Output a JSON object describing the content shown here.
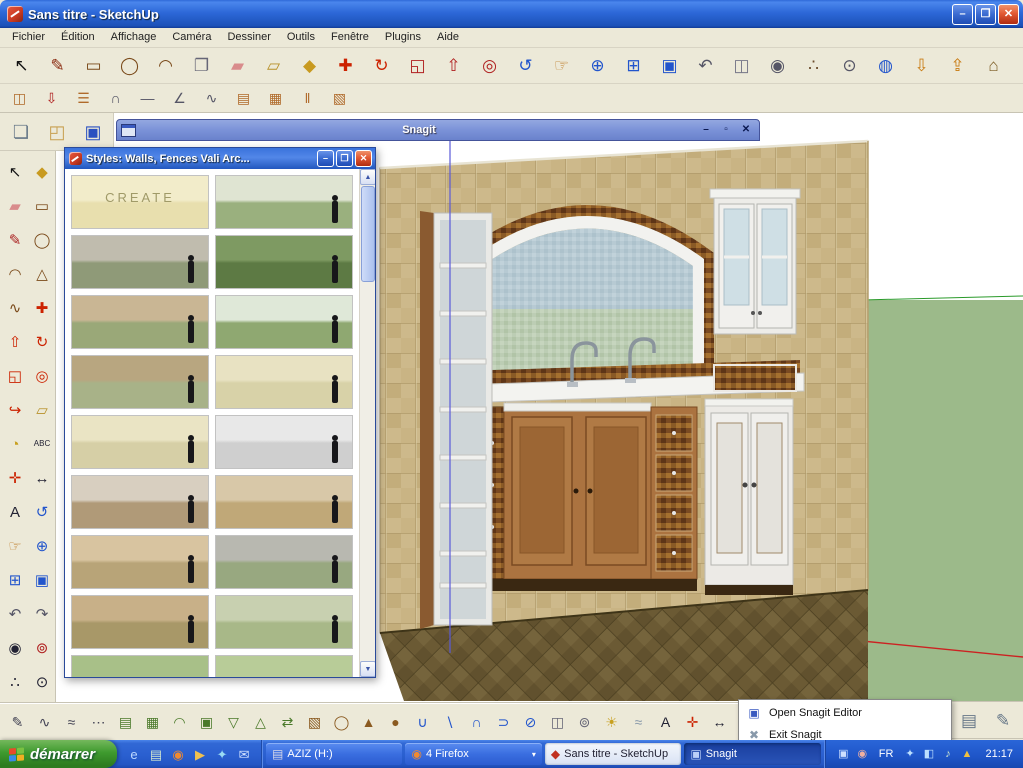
{
  "title_bar": {
    "title": "Sans titre - SketchUp",
    "controls": [
      {
        "n": "minimize-button",
        "g": "–"
      },
      {
        "n": "maximize-button",
        "g": "❐"
      },
      {
        "n": "close-button",
        "g": "✕"
      }
    ]
  },
  "menu_bar": {
    "items": [
      {
        "name": "menu-fichier",
        "label": "Fichier"
      },
      {
        "name": "menu-edition",
        "label": "Édition"
      },
      {
        "name": "menu-affichage",
        "label": "Affichage"
      },
      {
        "name": "menu-camera",
        "label": "Caméra"
      },
      {
        "name": "menu-dessiner",
        "label": "Dessiner"
      },
      {
        "name": "menu-outils",
        "label": "Outils"
      },
      {
        "name": "menu-fenetre",
        "label": "Fenêtre"
      },
      {
        "name": "menu-plugins",
        "label": "Plugins"
      },
      {
        "name": "menu-aide",
        "label": "Aide"
      }
    ]
  },
  "toolbar_main": {
    "icons": [
      {
        "n": "select-icon",
        "g": "↖",
        "c": "#111111"
      },
      {
        "n": "line-icon",
        "g": "✎",
        "c": "#8a2a10"
      },
      {
        "n": "rectangle-icon",
        "g": "▭",
        "c": "#7a4a1a"
      },
      {
        "n": "circle-icon",
        "g": "◯",
        "c": "#7a4a1a"
      },
      {
        "n": "arc-icon",
        "g": "◠",
        "c": "#7a4a1a"
      },
      {
        "n": "make-component-icon",
        "g": "❐",
        "c": "#666677"
      },
      {
        "n": "eraser-icon",
        "g": "▰",
        "c": "#d98c8c"
      },
      {
        "n": "tape-measure-icon",
        "g": "▱",
        "c": "#b8912a"
      },
      {
        "n": "paint-bucket-icon",
        "g": "◆",
        "c": "#c89a20"
      },
      {
        "n": "move-icon",
        "g": "✚",
        "c": "#cc2200"
      },
      {
        "n": "rotate-icon",
        "g": "↻",
        "c": "#cc2200"
      },
      {
        "n": "scale-icon",
        "g": "◱",
        "c": "#b02020"
      },
      {
        "n": "push-pull-icon",
        "g": "⇧",
        "c": "#b02020"
      },
      {
        "n": "offset-icon",
        "g": "◎",
        "c": "#b02020"
      },
      {
        "n": "orbit-icon",
        "g": "↺",
        "c": "#2255cc"
      },
      {
        "n": "pan-icon",
        "g": "☞",
        "c": "#c08030"
      },
      {
        "n": "zoom-icon",
        "g": "⊕",
        "c": "#2255cc"
      },
      {
        "n": "zoom-window-icon",
        "g": "⊞",
        "c": "#2255cc"
      },
      {
        "n": "zoom-extents-icon",
        "g": "▣",
        "c": "#2255cc"
      },
      {
        "n": "previous-view-icon",
        "g": "↶",
        "c": "#555566"
      },
      {
        "n": "section-plane-icon",
        "g": "◫",
        "c": "#777788"
      },
      {
        "n": "position-camera-icon",
        "g": "◉",
        "c": "#555566"
      },
      {
        "n": "walk-icon",
        "g": "∴",
        "c": "#6a4a2a"
      },
      {
        "n": "look-around-icon",
        "g": "⊙",
        "c": "#555566"
      },
      {
        "n": "geo-location-icon",
        "g": "◍",
        "c": "#2255cc"
      },
      {
        "n": "import-icon",
        "g": "⇩",
        "c": "#c87a10"
      },
      {
        "n": "export-icon",
        "g": "⇪",
        "c": "#c87a10"
      },
      {
        "n": "model-info-icon",
        "g": "⌂",
        "c": "#7a5a20"
      }
    ]
  },
  "toolbar_second": {
    "icons": [
      {
        "n": "door-tool-icon",
        "g": "◫",
        "c": "#b06a2a"
      },
      {
        "n": "import-component-icon",
        "g": "⇩",
        "c": "#b02020"
      },
      {
        "n": "stairs-tool-icon",
        "g": "☰",
        "c": "#b06a2a"
      },
      {
        "n": "roof-tool-icon",
        "g": "∩",
        "c": "#555566"
      },
      {
        "n": "line-segment-icon",
        "g": "―",
        "c": "#555566"
      },
      {
        "n": "angle-tool-icon",
        "g": "∠",
        "c": "#555566"
      },
      {
        "n": "freehand-curve-icon",
        "g": "∿",
        "c": "#555566"
      },
      {
        "n": "wall-tool-icon",
        "g": "▤",
        "c": "#b06a2a"
      },
      {
        "n": "fence-tool-icon",
        "g": "▦",
        "c": "#b06a2a"
      },
      {
        "n": "rail-tool-icon",
        "g": "‖",
        "c": "#b06a2a"
      },
      {
        "n": "frame-tool-icon",
        "g": "▧",
        "c": "#b06a2a"
      }
    ]
  },
  "toolbar_file": {
    "icons": [
      {
        "n": "new-document-icon",
        "g": "❏",
        "c": "#667788"
      },
      {
        "n": "open-folder-icon",
        "g": "◰",
        "c": "#c8a050"
      },
      {
        "n": "save-icon",
        "g": "▣",
        "c": "#2a50c0"
      }
    ]
  },
  "left_toolbar": {
    "icons": [
      {
        "n": "select-icon",
        "g": "↖",
        "c": "#111111"
      },
      {
        "n": "paint-bucket-icon",
        "g": "◆",
        "c": "#c89a20"
      },
      {
        "n": "eraser-icon",
        "g": "▰",
        "c": "#d98c8c"
      },
      {
        "n": "rectangle-icon",
        "g": "▭",
        "c": "#7a4a1a"
      },
      {
        "n": "line-icon",
        "g": "✎",
        "c": "#aa2222"
      },
      {
        "n": "circle-icon",
        "g": "◯",
        "c": "#7a4a1a"
      },
      {
        "n": "arc-icon",
        "g": "◠",
        "c": "#7a4a1a"
      },
      {
        "n": "polygon-icon",
        "g": "△",
        "c": "#7a4a1a"
      },
      {
        "n": "freehand-icon",
        "g": "∿",
        "c": "#7a4a1a"
      },
      {
        "n": "move-icon",
        "g": "✚",
        "c": "#cc2200"
      },
      {
        "n": "push-pull-icon",
        "g": "⇧",
        "c": "#cc2200"
      },
      {
        "n": "rotate-icon",
        "g": "↻",
        "c": "#cc2200"
      },
      {
        "n": "scale-icon",
        "g": "◱",
        "c": "#cc2200"
      },
      {
        "n": "offset-icon",
        "g": "◎",
        "c": "#cc2200"
      },
      {
        "n": "follow-me-icon",
        "g": "↪",
        "c": "#cc2200"
      },
      {
        "n": "tape-measure-icon",
        "g": "▱",
        "c": "#b8912a"
      },
      {
        "n": "protractor-icon",
        "g": "◔",
        "c": "#c8a020"
      },
      {
        "n": "text-icon",
        "g": "ABC",
        "c": "#222233",
        "s": 8
      },
      {
        "n": "axes-icon",
        "g": "✛",
        "c": "#cc2200"
      },
      {
        "n": "dimension-icon",
        "g": "↔",
        "c": "#222233"
      },
      {
        "n": "3d-text-icon",
        "g": "A",
        "c": "#222233"
      },
      {
        "n": "orbit-icon",
        "g": "↺",
        "c": "#2255cc"
      },
      {
        "n": "pan-icon",
        "g": "☞",
        "c": "#c08030"
      },
      {
        "n": "zoom-icon",
        "g": "⊕",
        "c": "#2255cc"
      },
      {
        "n": "zoom-window-icon",
        "g": "⊞",
        "c": "#2255cc"
      },
      {
        "n": "zoom-extents-icon",
        "g": "▣",
        "c": "#2255cc"
      },
      {
        "n": "previous-view-icon",
        "g": "↶",
        "c": "#555566"
      },
      {
        "n": "next-view-icon",
        "g": "↷",
        "c": "#555566"
      },
      {
        "n": "eye-icon",
        "g": "◉",
        "c": "#222233"
      },
      {
        "n": "position-camera-icon",
        "g": "⊚",
        "c": "#b02020"
      },
      {
        "n": "walk-icon",
        "g": "∴",
        "c": "#222233"
      },
      {
        "n": "look-around-icon",
        "g": "⊙",
        "c": "#222233"
      }
    ]
  },
  "bottom_toolbar": {
    "icons": [
      {
        "n": "freehand-plus-icon",
        "g": "✎",
        "c": "#444455"
      },
      {
        "n": "bezier-curve-icon",
        "g": "∿",
        "c": "#444455"
      },
      {
        "n": "polyline-icon",
        "g": "≈",
        "c": "#444455"
      },
      {
        "n": "point-set-icon",
        "g": "⋯",
        "c": "#444455"
      },
      {
        "n": "sandbox-contours-icon",
        "g": "▤",
        "c": "#4a7a2a"
      },
      {
        "n": "sandbox-scratch-icon",
        "g": "▦",
        "c": "#4a7a2a"
      },
      {
        "n": "smoove-icon",
        "g": "◠",
        "c": "#4a7a2a"
      },
      {
        "n": "stamp-icon",
        "g": "▣",
        "c": "#4a7a2a"
      },
      {
        "n": "drape-icon",
        "g": "▽",
        "c": "#4a7a2a"
      },
      {
        "n": "add-detail-icon",
        "g": "△",
        "c": "#4a7a2a"
      },
      {
        "n": "flip-edge-icon",
        "g": "⇄",
        "c": "#4a7a2a"
      },
      {
        "n": "box-primitive-icon",
        "g": "▧",
        "c": "#8a5a20"
      },
      {
        "n": "cylinder-primitive-icon",
        "g": "◯",
        "c": "#8a5a20"
      },
      {
        "n": "pyramid-primitive-icon",
        "g": "▲",
        "c": "#8a5a20"
      },
      {
        "n": "sphere-primitive-icon",
        "g": "●",
        "c": "#8a5a20"
      },
      {
        "n": "union-icon",
        "g": "∪",
        "c": "#2255cc"
      },
      {
        "n": "subtract-icon",
        "g": "∖",
        "c": "#2255cc"
      },
      {
        "n": "intersect-icon",
        "g": "∩",
        "c": "#2255cc"
      },
      {
        "n": "outer-shell-icon",
        "g": "⊃",
        "c": "#2255cc"
      },
      {
        "n": "split-icon",
        "g": "⊘",
        "c": "#2255cc"
      },
      {
        "n": "section-plane-icon",
        "g": "◫",
        "c": "#666677"
      },
      {
        "n": "camera-icon",
        "g": "⊚",
        "c": "#666677"
      },
      {
        "n": "shadows-icon",
        "g": "☀",
        "c": "#c8a020"
      },
      {
        "n": "fog-icon",
        "g": "≈",
        "c": "#8899aa"
      },
      {
        "n": "3d-text-icon",
        "g": "A",
        "c": "#222233"
      },
      {
        "n": "axes-icon",
        "g": "✛",
        "c": "#cc2200"
      },
      {
        "n": "dimensions-icon",
        "g": "↔",
        "c": "#222233"
      },
      {
        "n": "simplify-icon",
        "g": "✂",
        "c": "#666677"
      }
    ]
  },
  "snagit_window": {
    "title": "Snagit",
    "controls": [
      {
        "n": "minimize-button",
        "g": "–"
      },
      {
        "n": "maximize-button",
        "g": "▫"
      },
      {
        "n": "close-button",
        "g": "✕"
      }
    ]
  },
  "styles_window": {
    "title": "Styles: Walls, Fences   Vali Arc...",
    "controls": [
      {
        "n": "minimize-button",
        "g": "–"
      },
      {
        "n": "maximize-button",
        "g": "❐"
      },
      {
        "n": "close-button",
        "g": "✕"
      }
    ],
    "thumbnails": [
      {
        "n": "style-create",
        "label": "CREATE",
        "top": "#f2ecca",
        "bottom": "#e8dfae",
        "fig": 0
      },
      {
        "n": "style-iron-gate-fence",
        "top": "#dfe4d2",
        "bottom": "#9ab07e",
        "fig": 1
      },
      {
        "n": "style-stone-wall",
        "top": "#c0bcae",
        "bottom": "#8f9a78",
        "fig": 1
      },
      {
        "n": "style-green-mesh-fence",
        "top": "#7e9a62",
        "bottom": "#5d7a44",
        "fig": 1
      },
      {
        "n": "style-wood-board-fence",
        "top": "#c9b694",
        "bottom": "#9aa878",
        "fig": 1
      },
      {
        "n": "style-iron-picket-fence",
        "top": "#dfe8d8",
        "bottom": "#8fa871",
        "fig": 1
      },
      {
        "n": "style-wood-privacy-fence",
        "top": "#b8a680",
        "bottom": "#a8b288",
        "fig": 1
      },
      {
        "n": "style-split-rail-fence",
        "top": "#e8e2c2",
        "bottom": "#d8d2a8",
        "fig": 1
      },
      {
        "n": "style-rail-fence-field",
        "top": "#eae4c4",
        "bottom": "#d6cfa6",
        "fig": 1
      },
      {
        "n": "style-concrete-wall",
        "top": "#e8e8e8",
        "bottom": "#cfcfcf",
        "fig": 1
      },
      {
        "n": "style-brick-pillar-fence",
        "top": "#d8cfc0",
        "bottom": "#b09a78",
        "fig": 1
      },
      {
        "n": "style-stone-path-wall",
        "top": "#d8c8a8",
        "bottom": "#c0a878",
        "fig": 1
      },
      {
        "n": "style-lattice-wall",
        "top": "#d8c4a0",
        "bottom": "#b8a478",
        "fig": 1
      },
      {
        "n": "style-stone-retaining-wall",
        "top": "#b8b8b0",
        "bottom": "#98a880",
        "fig": 1
      },
      {
        "n": "style-wood-retaining-wall",
        "top": "#c8b088",
        "bottom": "#a89868",
        "fig": 1
      },
      {
        "n": "style-round-planter-wall",
        "top": "#c8d0b0",
        "bottom": "#a8b888",
        "fig": 1
      },
      {
        "n": "style-hedge-row",
        "top": "#a8c088",
        "bottom": "#88a868",
        "fig": 0
      },
      {
        "n": "style-grass-berm",
        "top": "#b8cc98",
        "bottom": "#98b478",
        "fig": 0
      }
    ]
  },
  "viewport": {
    "axis_colors": {
      "red": "#cc2222",
      "green": "#2a9a2a",
      "blue": "#5a5ad8"
    }
  },
  "tray_menu": {
    "items": [
      {
        "name": "menu-open-snagit-editor",
        "label": "Open Snagit Editor",
        "g": "▣",
        "c": "#3a5ac0"
      },
      {
        "name": "menu-exit-snagit",
        "label": "Exit Snagit",
        "g": "✖",
        "c": "#8899aa"
      }
    ]
  },
  "floating_panel": {
    "icons": [
      {
        "n": "snagit-printer-icon",
        "g": "▤",
        "c": "#667788"
      },
      {
        "n": "snagit-pen-icon",
        "g": "✎",
        "c": "#667788"
      }
    ]
  },
  "taskbar": {
    "start_label": "démarrer",
    "quick_launch": [
      {
        "n": "internet-explorer-icon",
        "g": "e",
        "c": "#bcd8ff"
      },
      {
        "n": "show-desktop-icon",
        "g": "▤",
        "c": "#cfe4cf"
      },
      {
        "n": "firefox-icon",
        "g": "◉",
        "c": "#f08a30"
      },
      {
        "n": "media-player-icon",
        "g": "▶",
        "c": "#f0c050"
      },
      {
        "n": "messenger-icon",
        "g": "✦",
        "c": "#9adcf4"
      },
      {
        "n": "mail-icon",
        "g": "✉",
        "c": "#cfe0ff"
      }
    ],
    "tasks": [
      {
        "name": "task-aziz-drive",
        "label": "AZIZ (H:)",
        "state": "normal",
        "icon_g": "▤",
        "icon_c": "#d8d8e8",
        "arrow": ""
      },
      {
        "name": "task-firefox-group",
        "label": "4 Firefox",
        "state": "normal",
        "icon_g": "◉",
        "icon_c": "#f08a30",
        "arrow": "▾"
      },
      {
        "name": "task-sketchup",
        "label": "Sans titre - SketchUp",
        "state": "active",
        "icon_g": "◆",
        "icon_c": "#c03020",
        "arrow": ""
      },
      {
        "name": "task-snagit",
        "label": "Snagit",
        "state": "pressed",
        "icon_g": "▣",
        "icon_c": "#bcd0f8",
        "arrow": ""
      }
    ],
    "tray_left": [
      {
        "n": "snagit-tray-icon",
        "g": "▣",
        "c": "#cfe0ff"
      },
      {
        "n": "capture-tray-icon",
        "g": "◉",
        "c": "#f0b0a0"
      }
    ],
    "language": "FR",
    "tray_right": [
      {
        "n": "messenger-tray-icon",
        "g": "✦",
        "c": "#bce0ff"
      },
      {
        "n": "network-tray-icon",
        "g": "◧",
        "c": "#bce0ff"
      },
      {
        "n": "volume-tray-icon",
        "g": "♪",
        "c": "#cfe8cf"
      },
      {
        "n": "update-shield-icon",
        "g": "▲",
        "c": "#f0c040"
      }
    ],
    "time": "21:17"
  }
}
